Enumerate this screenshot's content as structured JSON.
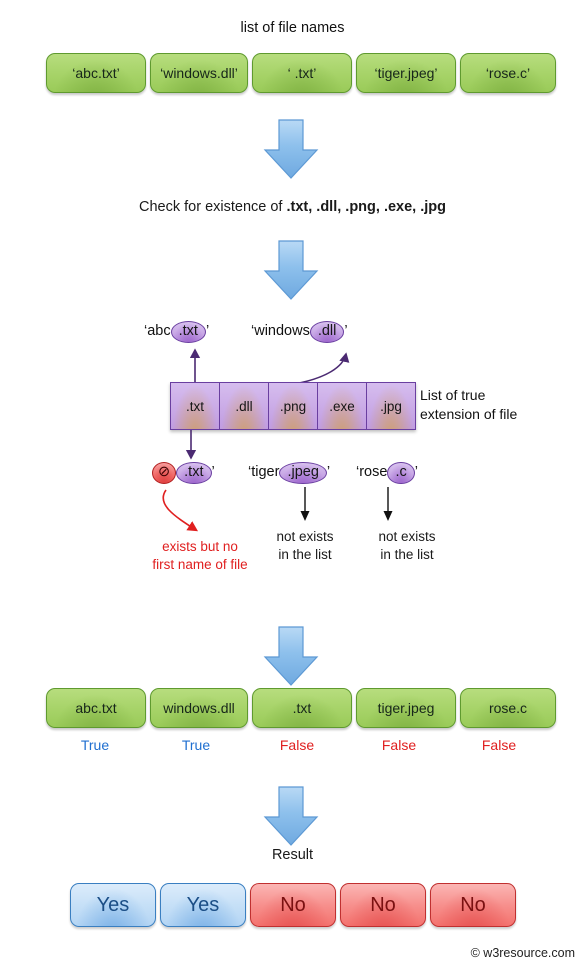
{
  "header": {
    "title": "list of file names"
  },
  "input_files": [
    {
      "label": "‘abc.txt’"
    },
    {
      "label": "‘windows.dll’"
    },
    {
      "label": "‘ .txt’"
    },
    {
      "label": "‘tiger.jpeg’"
    },
    {
      "label": "‘rose.c’"
    }
  ],
  "check_step": {
    "prefix": "Check for existence of ",
    "extensions": ".txt, .dll, .png, .exe, .jpg"
  },
  "matches": {
    "abc": {
      "name": "‘abc",
      "ext": ".txt",
      "close": "’"
    },
    "windows": {
      "name": "‘windows",
      "ext": ".dll",
      "close": "’"
    },
    "blank": {
      "slash": "⊘",
      "ext": ".txt",
      "close": "’"
    },
    "tiger": {
      "name": "‘tiger",
      "ext": ".jpeg",
      "close": "’"
    },
    "rose": {
      "name": "‘rose",
      "ext": ".c",
      "close": "’"
    }
  },
  "ext_list": {
    "items": [
      ".txt",
      ".dll",
      ".png",
      ".exe",
      ".jpg"
    ],
    "side_label_line1": "List of true",
    "side_label_line2": "extension of file"
  },
  "notes": {
    "blank_note_line1": "exists but no",
    "blank_note_line2": "first name of file",
    "tiger_note_line1": "not exists",
    "tiger_note_line2": "in the list",
    "rose_note_line1": "not exists",
    "rose_note_line2": "in the list"
  },
  "bool_row": {
    "files": [
      "abc.txt",
      "windows.dll",
      ".txt",
      "tiger.jpeg",
      "rose.c"
    ],
    "values": [
      "True",
      "True",
      "False",
      "False",
      "False"
    ]
  },
  "result": {
    "label": "Result",
    "values": [
      "Yes",
      "Yes",
      "No",
      "No",
      "No"
    ]
  },
  "credit": "© w3resource.com",
  "colors": {
    "green": "#a8d46a",
    "purple": "#c9a9e6",
    "blue_arrow": "#84bbec",
    "true": "#1f6fd0",
    "false": "#e02020",
    "red": "#f4736f"
  }
}
